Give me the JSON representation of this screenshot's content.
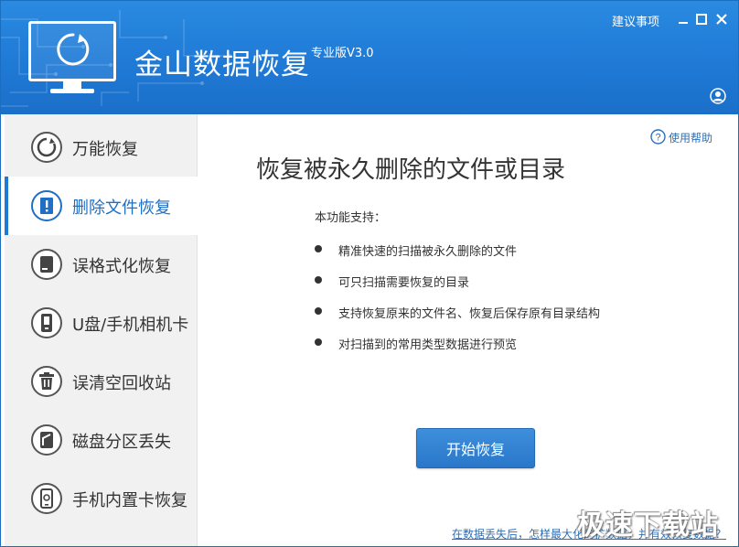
{
  "header": {
    "title": "金山数据恢复",
    "edition": "专业版V3.0",
    "feedback_link": "建议事项",
    "colors": {
      "header_blue": "#1f7ad6",
      "accent": "#1f6fc4"
    }
  },
  "sidebar": {
    "items": [
      {
        "label": "万能恢复",
        "icon": "refresh-circle-icon",
        "active": false
      },
      {
        "label": "删除文件恢复",
        "icon": "exclamation-document-icon",
        "active": true
      },
      {
        "label": "误格式化恢复",
        "icon": "hard-drive-icon",
        "active": false
      },
      {
        "label": "U盘/手机相机卡",
        "icon": "usb-device-icon",
        "active": false
      },
      {
        "label": "误清空回收站",
        "icon": "trash-icon",
        "active": false
      },
      {
        "label": "磁盘分区丢失",
        "icon": "partition-icon",
        "active": false
      },
      {
        "label": "手机内置卡恢复",
        "icon": "phone-icon",
        "active": false
      }
    ]
  },
  "main": {
    "help_label": "使用帮助",
    "title": "恢复被永久删除的文件或目录",
    "support_label": "本功能支持：",
    "features": [
      "精准快速的扫描被永久删除的文件",
      "可只扫描需要恢复的目录",
      "支持恢复原来的文件名、恢复后保存原有目录结构",
      "对扫描到的常用类型数据进行预览"
    ],
    "start_button": "开始恢复",
    "bottom_link": "在数据丢失后，怎样最大化的扩数据，并有效恢复数据？"
  },
  "watermark": "极速下载站"
}
